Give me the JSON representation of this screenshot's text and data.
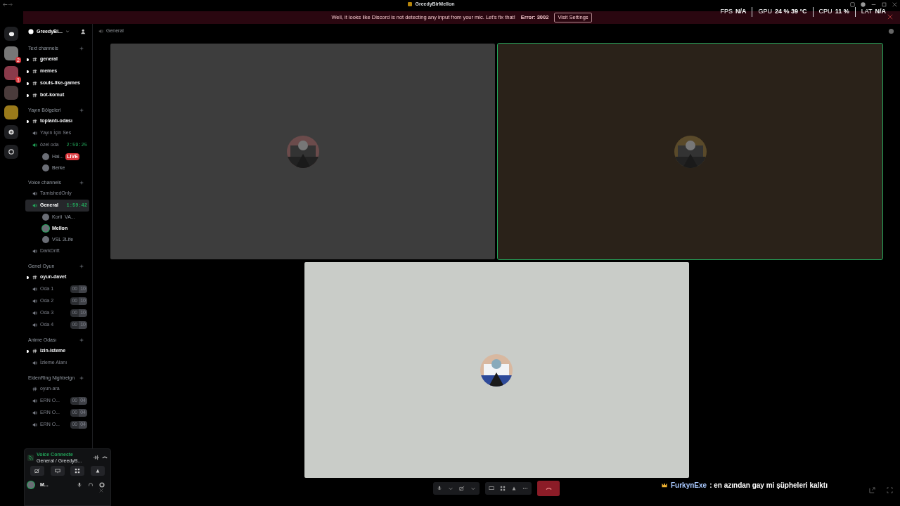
{
  "window": {
    "title": "GreedyBirMellon"
  },
  "banner": {
    "text": "Well, it looks like Discord is not detecting any input from your mic. Let's fix that!",
    "error": "Error: 3002",
    "button": "Visit Settings"
  },
  "stats": [
    {
      "label": "FPS",
      "value": "N/A"
    },
    {
      "label": "GPU",
      "value": "24 % 39 °C"
    },
    {
      "label": "CPU",
      "value": "11 %"
    },
    {
      "label": "LAT",
      "value": "N/A"
    }
  ],
  "servers": [
    {
      "kind": "badged",
      "badge": "2"
    },
    {
      "kind": "badged",
      "badge": "1"
    },
    {
      "kind": "plain"
    },
    {
      "kind": "plain"
    }
  ],
  "server_name": "GreedyBi...",
  "header": {
    "channel": "General"
  },
  "categories": [
    {
      "name": "Text channels",
      "channels": [
        {
          "kind": "text",
          "name": "general",
          "unread": true
        },
        {
          "kind": "text",
          "name": "memes",
          "unread": true
        },
        {
          "kind": "text",
          "name": "souls-like-games",
          "unread": true
        },
        {
          "kind": "text",
          "name": "bot-komut",
          "unread": true
        }
      ]
    },
    {
      "name": "Yayın Bölgeleri",
      "channels": [
        {
          "kind": "text",
          "name": "toplantı-odası",
          "unread": true
        },
        {
          "kind": "voice",
          "name": "Yayın İçin Ses",
          "active": false
        },
        {
          "kind": "voice",
          "name": "özel oda",
          "active": true,
          "timer": "2:59:25",
          "users": [
            {
              "name": "Hai...",
              "live": "LIVE",
              "speaking": false
            },
            {
              "name": "Berke",
              "speaking": false
            }
          ]
        }
      ]
    },
    {
      "name": "Voice channels",
      "channels": [
        {
          "kind": "voice",
          "name": "TarnishedOnly",
          "active": false
        },
        {
          "kind": "voice",
          "name": "General",
          "active": true,
          "selected": true,
          "timer": "1:59:42",
          "users": [
            {
              "name": "Korii",
              "activity": "VA...",
              "speaking": false
            },
            {
              "name": "Mellon",
              "speaking": true
            },
            {
              "name": "VSL 2Life",
              "speaking": false
            }
          ]
        },
        {
          "kind": "voice",
          "name": "DarkDrift",
          "active": false
        }
      ]
    },
    {
      "name": "Genel Oyun",
      "channels": [
        {
          "kind": "text",
          "name": "oyun-davet",
          "unread": true
        },
        {
          "kind": "voice",
          "name": "Oda 1",
          "active": false,
          "count": "00",
          "limit": "10"
        },
        {
          "kind": "voice",
          "name": "Oda 2",
          "active": false,
          "count": "00",
          "limit": "10"
        },
        {
          "kind": "voice",
          "name": "Oda 3",
          "active": false,
          "count": "00",
          "limit": "10"
        },
        {
          "kind": "voice",
          "name": "Oda 4",
          "active": false,
          "count": "00",
          "limit": "10"
        }
      ]
    },
    {
      "name": "Anime Odası",
      "channels": [
        {
          "kind": "text",
          "name": "izin-isteme",
          "unread": true
        },
        {
          "kind": "voice",
          "name": "İzleme Alanı",
          "active": false
        }
      ]
    },
    {
      "name": "EldenRing Nightreign",
      "channels": [
        {
          "kind": "text",
          "name": "oyun-ara",
          "unread": false
        },
        {
          "kind": "voice",
          "name": "ERN O...",
          "active": false,
          "count": "00",
          "limit": "04"
        },
        {
          "kind": "voice",
          "name": "ERN O...",
          "active": false,
          "count": "00",
          "limit": "04"
        },
        {
          "kind": "voice",
          "name": "ERN O...",
          "active": false,
          "count": "00",
          "limit": "04"
        }
      ]
    }
  ],
  "voice_panel": {
    "status": "Voice Connecte",
    "location": "General / GreedyB..."
  },
  "user": {
    "name": "M..."
  },
  "tiles": [
    {
      "speaking": false
    },
    {
      "speaking": true
    },
    {
      "speaking": false
    }
  ],
  "chat": {
    "author": "FurkynExe",
    "text": ": en azından gay mi şüpheleri kalktı"
  }
}
